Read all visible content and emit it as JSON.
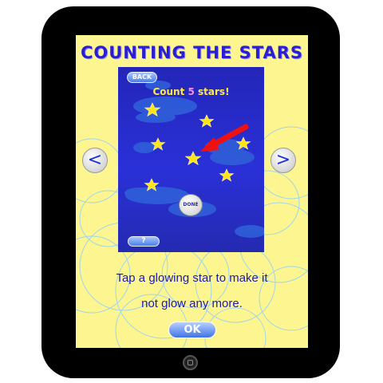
{
  "app": {
    "title": "COUNTING THE STARS"
  },
  "game": {
    "back_label": "BACK",
    "prompt_prefix": "Count ",
    "prompt_number": "5",
    "prompt_suffix": " stars!",
    "done_label": "DONE",
    "help_label": "?"
  },
  "nav": {
    "prev_label": "<",
    "next_label": ">"
  },
  "instructions": {
    "line1": "Tap a glowing star to make it",
    "line2": "not glow any more.",
    "ok_label": "OK"
  },
  "colors": {
    "screen_bg": "#fdf58f",
    "title": "#2a1fd0",
    "game_bg": "#2a30d8",
    "star": "#ffe41a",
    "arrow": "#ee1111",
    "instruction_text": "#1b1bb0"
  },
  "icons": {
    "prev": "chevron-left-icon",
    "next": "chevron-right-icon",
    "pointer": "red-arrow-icon",
    "home": "home-button-icon"
  }
}
